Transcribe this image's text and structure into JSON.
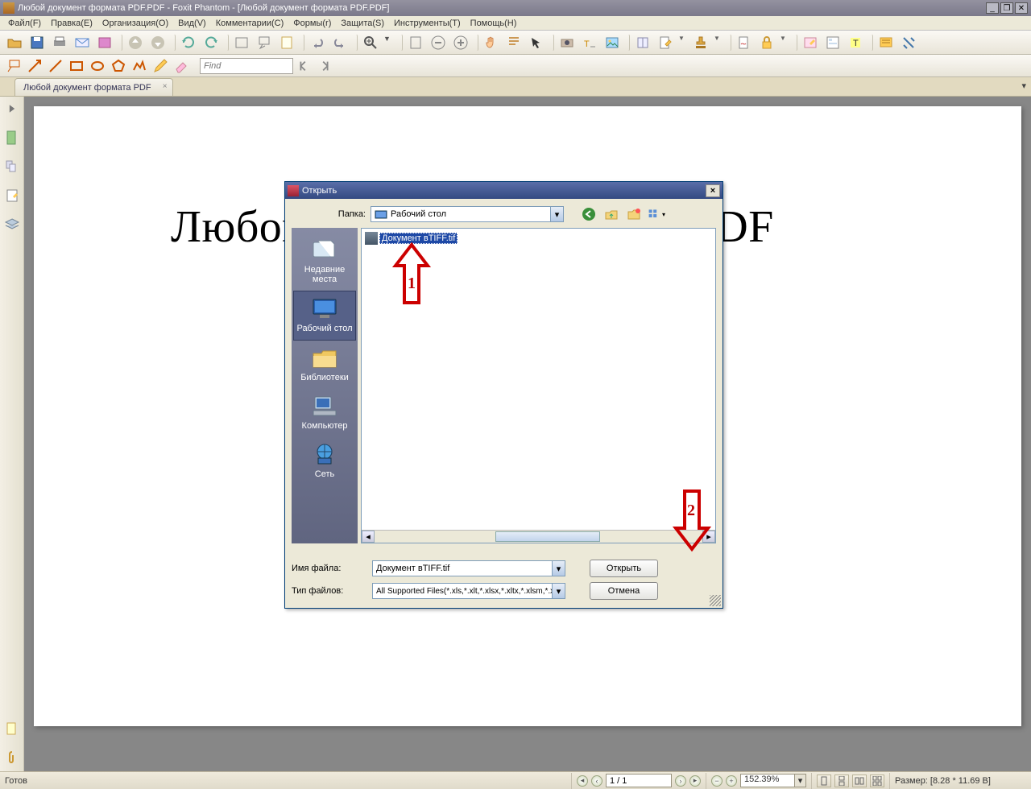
{
  "window": {
    "title": "Любой документ формата PDF.PDF - Foxit Phantom - [Любой документ формата PDF.PDF]"
  },
  "menu": {
    "file": "Файл(F)",
    "edit": "Правка(E)",
    "org": "Организация(O)",
    "view": "Вид(V)",
    "comment": "Комментарии(C)",
    "form": "Формы(r)",
    "protect": "Защита(S)",
    "tools": "Инструменты(T)",
    "help": "Помощь(H)"
  },
  "search": {
    "placeholder": "Find"
  },
  "tab": {
    "label": "Любой документ формата PDF"
  },
  "page_text": "Любой документ формата PDF",
  "dialog": {
    "title": "Открыть",
    "folder_label": "Папка:",
    "folder_value": "Рабочий стол",
    "places": {
      "recent": "Недавние места",
      "desktop": "Рабочий стол",
      "libs": "Библиотеки",
      "computer": "Компьютер",
      "network": "Сеть"
    },
    "file_item": "Документ вTIFF.tif",
    "filename_label": "Имя файла:",
    "filename_value": "Документ вTIFF.tif",
    "filetype_label": "Тип файлов:",
    "filetype_value": "All Supported Files(*.xls,*.xlt,*.xlsx,*.xltx,*.xlsm,*.xls",
    "open_btn": "Открыть",
    "cancel_btn": "Отмена",
    "annot1": "1",
    "annot2": "2"
  },
  "status": {
    "ready": "Готов",
    "page": "1 / 1",
    "zoom": "152.39%",
    "size": "Размер: [8.28 * 11.69 B]"
  }
}
